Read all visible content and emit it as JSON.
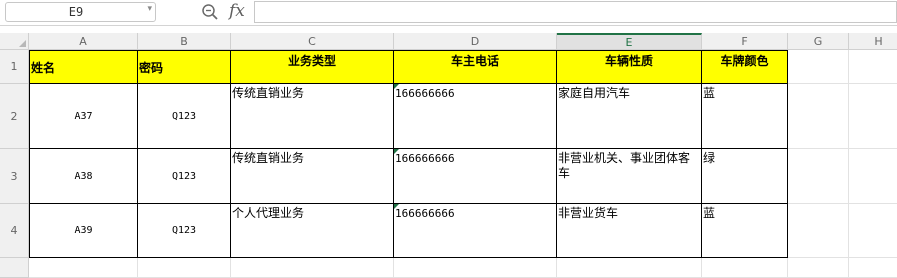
{
  "formula_bar": {
    "cell_ref": "E9",
    "fx_label": "fx",
    "formula_value": "",
    "zoom_icon": "magnifier-icon",
    "dropdown_icon": "chevron-down-icon"
  },
  "columns": [
    "A",
    "B",
    "C",
    "D",
    "E",
    "F",
    "G",
    "H"
  ],
  "selected_column": "E",
  "rows": [
    "1",
    "2",
    "3",
    "4"
  ],
  "header_row": [
    "姓名",
    "密码",
    "业务类型",
    "车主电话",
    "车辆性质",
    "车牌颜色"
  ],
  "data_rows": [
    [
      "A37",
      "Q123",
      "传统直销业务",
      "166666666",
      "家庭自用汽车",
      "蓝"
    ],
    [
      "A38",
      "Q123",
      "传统直销业务",
      "166666666",
      "非营业机关、事业团体客车",
      "绿"
    ],
    [
      "A39",
      "Q123",
      "个人代理业务",
      "166666666",
      "非营业货车",
      "蓝"
    ]
  ],
  "colors": {
    "header_fill": "#ffff00",
    "accent": "#217346",
    "gridline": "#e2e2e2"
  }
}
